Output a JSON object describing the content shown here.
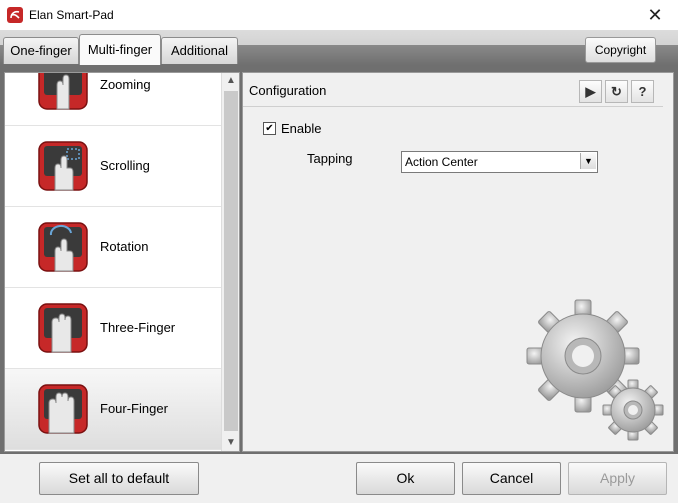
{
  "window": {
    "title": "Elan Smart-Pad"
  },
  "tabs": [
    {
      "label": "One-finger",
      "active": false
    },
    {
      "label": "Multi-finger",
      "active": true
    },
    {
      "label": "Additional",
      "active": false
    }
  ],
  "header": {
    "copyright_label": "Copyright"
  },
  "gestures": [
    {
      "label": "Zooming",
      "icon": "zoom-gesture-icon"
    },
    {
      "label": "Scrolling",
      "icon": "scroll-gesture-icon"
    },
    {
      "label": "Rotation",
      "icon": "rotation-gesture-icon"
    },
    {
      "label": "Three-Finger",
      "icon": "three-finger-gesture-icon"
    },
    {
      "label": "Four-Finger",
      "icon": "four-finger-gesture-icon",
      "selected": true
    }
  ],
  "config": {
    "title": "Configuration",
    "enable_label": "Enable",
    "enable_checked": true,
    "tapping_label": "Tapping",
    "tapping_value": "Action Center"
  },
  "footer": {
    "set_default_label": "Set all to default",
    "ok_label": "Ok",
    "cancel_label": "Cancel",
    "apply_label": "Apply"
  },
  "colors": {
    "accent_red": "#c62828",
    "band_gray": "#6f6f6f"
  }
}
